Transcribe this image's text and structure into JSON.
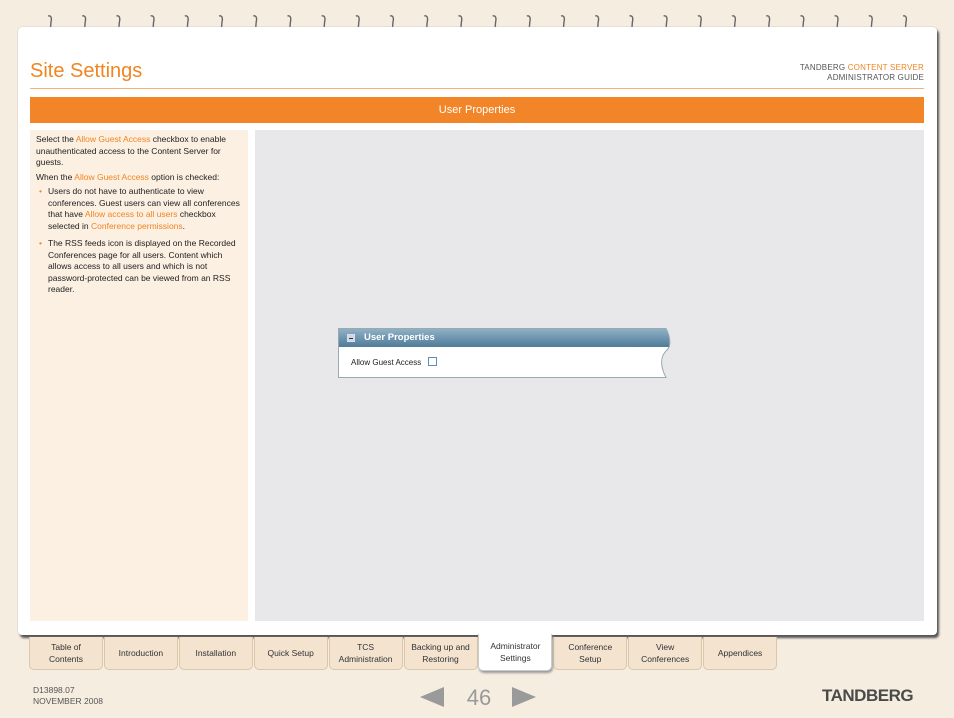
{
  "header": {
    "title": "Site Settings",
    "brand_line1_a": "TANDBERG ",
    "brand_line1_b": "CONTENT SERVER",
    "brand_line2": "ADMINISTRATOR GUIDE"
  },
  "banner": "User Properties",
  "sidebar": {
    "p1_a": "Select the ",
    "p1_link": "Allow Guest Access",
    "p1_b": " checkbox to enable unauthenticated access to the Content Server for guests.",
    "p2_a": "When the ",
    "p2_link": "Allow Guest Access",
    "p2_b": " option is checked:",
    "b1_a": "Users do not have to authenticate to view conferences. Guest users can view all conferences that have ",
    "b1_link1": "Allow access to all users",
    "b1_b": " checkbox selected in ",
    "b1_link2": "Conference permissions",
    "b1_c": ".",
    "b2": "The RSS feeds icon is displayed on the Recorded Conferences page for all users. Content which allows access to all users and which is not password-protected can be viewed from an RSS reader."
  },
  "widget": {
    "title": "User Properties",
    "field_label": "Allow Guest Access",
    "checked": false
  },
  "tabs": [
    {
      "label1": "Table of",
      "label2": "Contents"
    },
    {
      "label1": "Introduction",
      "label2": ""
    },
    {
      "label1": "Installation",
      "label2": ""
    },
    {
      "label1": "Quick Setup",
      "label2": ""
    },
    {
      "label1": "TCS",
      "label2": "Administration"
    },
    {
      "label1": "Backing up and",
      "label2": "Restoring"
    },
    {
      "label1": "Administrator",
      "label2": "Settings"
    },
    {
      "label1": "Conference",
      "label2": "Setup"
    },
    {
      "label1": "View",
      "label2": "Conferences"
    },
    {
      "label1": "Appendices",
      "label2": ""
    }
  ],
  "active_tab": 6,
  "footer": {
    "doc_id": "D13898.07",
    "date": "NOVEMBER 2008",
    "page_number": "46",
    "logo": "TANDBERG"
  },
  "colors": {
    "accent": "#f28527",
    "sidebar_bg": "#fcf0e2",
    "panel_bg": "#e8e8ea",
    "widget_header": "#5f8aa6"
  }
}
